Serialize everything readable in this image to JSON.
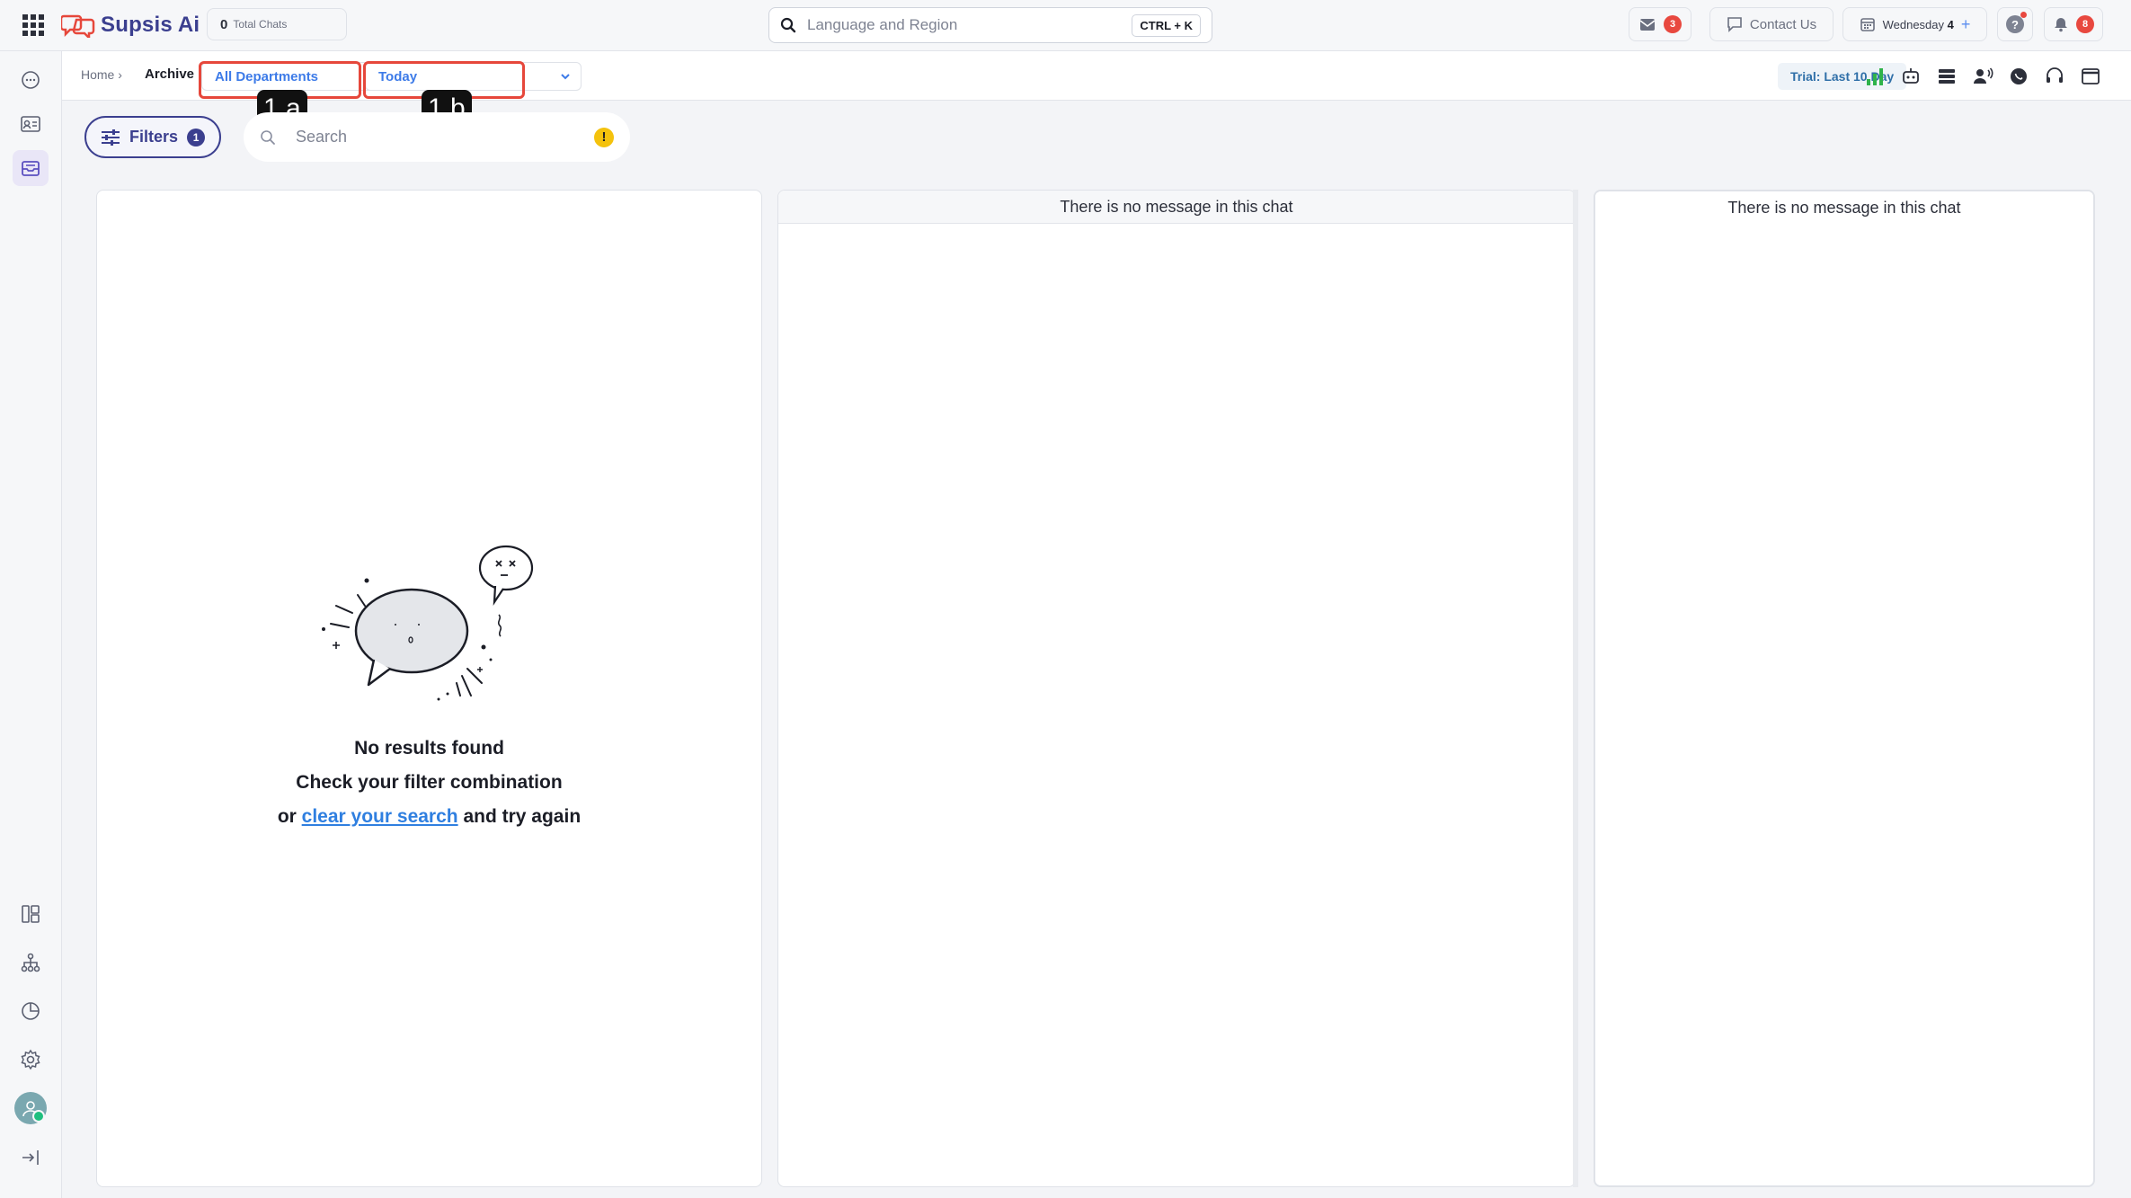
{
  "app": {
    "name": "Supsis Ai"
  },
  "topbar": {
    "total_chats_count": "0",
    "total_chats_label": "Total Chats",
    "search_placeholder": "Language and Region",
    "search_shortcut": "CTRL + K",
    "inbox_badge": "3",
    "contact_label": "Contact Us",
    "date_day": "Wednesday",
    "date_num": "4",
    "date_plus": "+",
    "help_label": "?",
    "notif_badge": "8"
  },
  "breadcrumb": {
    "home": "Home ›",
    "current": "Archive"
  },
  "dropdowns": {
    "department": "All Departments",
    "date_range": "Today"
  },
  "annotations": {
    "a": "1.a",
    "b": "1.b"
  },
  "trial": "Trial: Last 10 Day",
  "filters": {
    "label": "Filters",
    "count": "1"
  },
  "search": {
    "placeholder": "Search",
    "warn": "!"
  },
  "empty_state": {
    "title": "No results found",
    "line2": "Check your filter combination",
    "line3_prefix": "or",
    "line3_link": "clear your search",
    "line3_suffix": "and try again"
  },
  "panels": {
    "middle_message": "There is no message in this chat",
    "right_message": "There is no message in this chat"
  },
  "colors": {
    "brand": "#3b3f8f",
    "accent": "#3d7be8",
    "alert": "#e8483f",
    "highlight": "#e6473b"
  }
}
